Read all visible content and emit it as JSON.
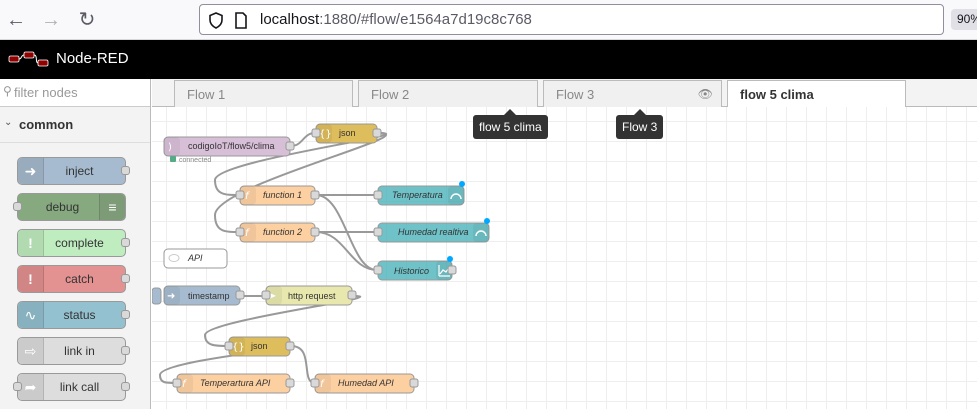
{
  "browser": {
    "url_host": "localhost",
    "url_rest": ":1880/#flow/e1564a7d19c8c768",
    "zoom": "90%"
  },
  "app": {
    "title": "Node-RED"
  },
  "palette": {
    "filter_placeholder": "filter nodes",
    "category": "common",
    "nodes": [
      {
        "label": "inject",
        "color": "#a6bbcf",
        "icon": "inject-icon"
      },
      {
        "label": "debug",
        "color": "#87a980",
        "icon": "debug-icon"
      },
      {
        "label": "complete",
        "color": "#c0edc0",
        "icon": "complete-icon"
      },
      {
        "label": "catch",
        "color": "#e49191",
        "icon": "catch-icon"
      },
      {
        "label": "status",
        "color": "#94c1d0",
        "icon": "status-icon"
      },
      {
        "label": "link in",
        "color": "#dddddd",
        "icon": "link-in-icon"
      },
      {
        "label": "link call",
        "color": "#dddddd",
        "icon": "link-call-icon"
      }
    ]
  },
  "tabs": [
    {
      "label": "Flow 1"
    },
    {
      "label": "Flow 2"
    },
    {
      "label": "Flow 3"
    },
    {
      "label": "flow 5 clima"
    }
  ],
  "tooltips": {
    "flow5": "flow 5 clima",
    "flow3": "Flow 3"
  },
  "flow_nodes": {
    "mqtt_in": {
      "label": "codigoIoT/flow5/clima",
      "status": "connected",
      "color": "#d8bfd8"
    },
    "json1": {
      "label": "json",
      "color": "#debd5c"
    },
    "function1": {
      "label": "function 1",
      "color": "#fdd0a2"
    },
    "function2": {
      "label": "function 2",
      "color": "#fdd0a2"
    },
    "temperatura": {
      "label": "Temperatura",
      "color": "#3fadb5"
    },
    "humedad": {
      "label": "Humedad realtiva",
      "color": "#3fadb5"
    },
    "historico": {
      "label": "Historico",
      "color": "#3fadb5"
    },
    "comment_api": {
      "label": "API",
      "color": "#ffffff"
    },
    "timestamp": {
      "label": "timestamp",
      "color": "#a6bbcf"
    },
    "http_request": {
      "label": "http request",
      "color": "#e7e7ae"
    },
    "json2": {
      "label": "json",
      "color": "#debd5c"
    },
    "temp_api": {
      "label": "Temperartura API",
      "color": "#fdd0a2"
    },
    "hum_api": {
      "label": "Humedad API",
      "color": "#fdd0a2"
    }
  }
}
